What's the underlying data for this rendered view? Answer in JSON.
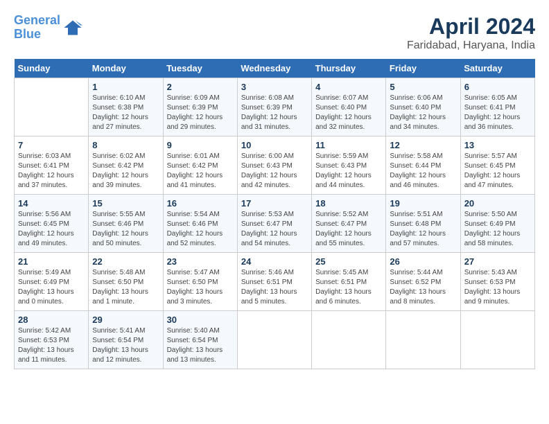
{
  "logo": {
    "line1": "General",
    "line2": "Blue"
  },
  "title": "April 2024",
  "subtitle": "Faridabad, Haryana, India",
  "weekdays": [
    "Sunday",
    "Monday",
    "Tuesday",
    "Wednesday",
    "Thursday",
    "Friday",
    "Saturday"
  ],
  "weeks": [
    [
      {
        "num": "",
        "info": ""
      },
      {
        "num": "1",
        "info": "Sunrise: 6:10 AM\nSunset: 6:38 PM\nDaylight: 12 hours\nand 27 minutes."
      },
      {
        "num": "2",
        "info": "Sunrise: 6:09 AM\nSunset: 6:39 PM\nDaylight: 12 hours\nand 29 minutes."
      },
      {
        "num": "3",
        "info": "Sunrise: 6:08 AM\nSunset: 6:39 PM\nDaylight: 12 hours\nand 31 minutes."
      },
      {
        "num": "4",
        "info": "Sunrise: 6:07 AM\nSunset: 6:40 PM\nDaylight: 12 hours\nand 32 minutes."
      },
      {
        "num": "5",
        "info": "Sunrise: 6:06 AM\nSunset: 6:40 PM\nDaylight: 12 hours\nand 34 minutes."
      },
      {
        "num": "6",
        "info": "Sunrise: 6:05 AM\nSunset: 6:41 PM\nDaylight: 12 hours\nand 36 minutes."
      }
    ],
    [
      {
        "num": "7",
        "info": "Sunrise: 6:03 AM\nSunset: 6:41 PM\nDaylight: 12 hours\nand 37 minutes."
      },
      {
        "num": "8",
        "info": "Sunrise: 6:02 AM\nSunset: 6:42 PM\nDaylight: 12 hours\nand 39 minutes."
      },
      {
        "num": "9",
        "info": "Sunrise: 6:01 AM\nSunset: 6:42 PM\nDaylight: 12 hours\nand 41 minutes."
      },
      {
        "num": "10",
        "info": "Sunrise: 6:00 AM\nSunset: 6:43 PM\nDaylight: 12 hours\nand 42 minutes."
      },
      {
        "num": "11",
        "info": "Sunrise: 5:59 AM\nSunset: 6:43 PM\nDaylight: 12 hours\nand 44 minutes."
      },
      {
        "num": "12",
        "info": "Sunrise: 5:58 AM\nSunset: 6:44 PM\nDaylight: 12 hours\nand 46 minutes."
      },
      {
        "num": "13",
        "info": "Sunrise: 5:57 AM\nSunset: 6:45 PM\nDaylight: 12 hours\nand 47 minutes."
      }
    ],
    [
      {
        "num": "14",
        "info": "Sunrise: 5:56 AM\nSunset: 6:45 PM\nDaylight: 12 hours\nand 49 minutes."
      },
      {
        "num": "15",
        "info": "Sunrise: 5:55 AM\nSunset: 6:46 PM\nDaylight: 12 hours\nand 50 minutes."
      },
      {
        "num": "16",
        "info": "Sunrise: 5:54 AM\nSunset: 6:46 PM\nDaylight: 12 hours\nand 52 minutes."
      },
      {
        "num": "17",
        "info": "Sunrise: 5:53 AM\nSunset: 6:47 PM\nDaylight: 12 hours\nand 54 minutes."
      },
      {
        "num": "18",
        "info": "Sunrise: 5:52 AM\nSunset: 6:47 PM\nDaylight: 12 hours\nand 55 minutes."
      },
      {
        "num": "19",
        "info": "Sunrise: 5:51 AM\nSunset: 6:48 PM\nDaylight: 12 hours\nand 57 minutes."
      },
      {
        "num": "20",
        "info": "Sunrise: 5:50 AM\nSunset: 6:49 PM\nDaylight: 12 hours\nand 58 minutes."
      }
    ],
    [
      {
        "num": "21",
        "info": "Sunrise: 5:49 AM\nSunset: 6:49 PM\nDaylight: 13 hours\nand 0 minutes."
      },
      {
        "num": "22",
        "info": "Sunrise: 5:48 AM\nSunset: 6:50 PM\nDaylight: 13 hours\nand 1 minute."
      },
      {
        "num": "23",
        "info": "Sunrise: 5:47 AM\nSunset: 6:50 PM\nDaylight: 13 hours\nand 3 minutes."
      },
      {
        "num": "24",
        "info": "Sunrise: 5:46 AM\nSunset: 6:51 PM\nDaylight: 13 hours\nand 5 minutes."
      },
      {
        "num": "25",
        "info": "Sunrise: 5:45 AM\nSunset: 6:51 PM\nDaylight: 13 hours\nand 6 minutes."
      },
      {
        "num": "26",
        "info": "Sunrise: 5:44 AM\nSunset: 6:52 PM\nDaylight: 13 hours\nand 8 minutes."
      },
      {
        "num": "27",
        "info": "Sunrise: 5:43 AM\nSunset: 6:53 PM\nDaylight: 13 hours\nand 9 minutes."
      }
    ],
    [
      {
        "num": "28",
        "info": "Sunrise: 5:42 AM\nSunset: 6:53 PM\nDaylight: 13 hours\nand 11 minutes."
      },
      {
        "num": "29",
        "info": "Sunrise: 5:41 AM\nSunset: 6:54 PM\nDaylight: 13 hours\nand 12 minutes."
      },
      {
        "num": "30",
        "info": "Sunrise: 5:40 AM\nSunset: 6:54 PM\nDaylight: 13 hours\nand 13 minutes."
      },
      {
        "num": "",
        "info": ""
      },
      {
        "num": "",
        "info": ""
      },
      {
        "num": "",
        "info": ""
      },
      {
        "num": "",
        "info": ""
      }
    ]
  ]
}
